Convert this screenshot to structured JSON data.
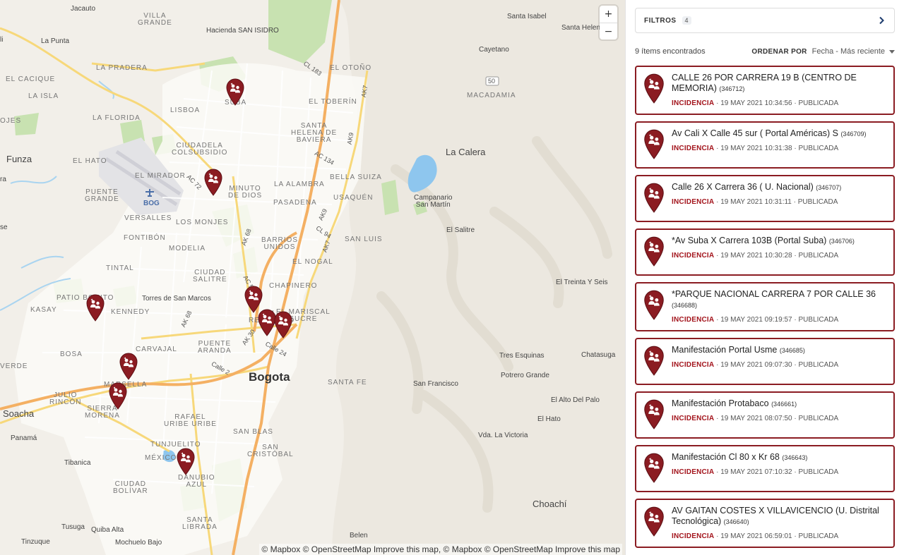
{
  "colors": {
    "accent": "#8b1c22",
    "incident_red": "#a3141c",
    "map_land": "#f2efe9",
    "park_green": "#c8e2b1",
    "water": "#8ec6ee",
    "highway_orange": "#f4b063",
    "main_road_yellow": "#f7d87a"
  },
  "map": {
    "zoom": {
      "in_label": "+",
      "out_label": "−"
    },
    "attribution": "© Mapbox © OpenStreetMap Improve this map, © Mapbox © OpenStreetMap Improve this map",
    "labels": {
      "jacauto": "Jacauto",
      "villa_grande": "VILLA\nGRANDE",
      "hacienda": "Hacienda SAN ISIDRO",
      "santa_isabel": "Santa Isabel",
      "santa_helena": "Santa Helena",
      "la_punta": "La Punta",
      "cayetano": "Cayetano",
      "la_pradera": "LA PRADERA",
      "el_otono": "EL OTOÑO",
      "el_cacique": "EL CACIQUE",
      "macadamia": "MACADAMIA",
      "la_isla": "LA ISLA",
      "suba": "SUBA",
      "el_tobern": "EL TOBERÍN",
      "lisboa": "LISBOA",
      "la_florida": "LA FLORIDA",
      "santa_helena_baviera": "SANTA\nHELENA DE\nBAVIERA",
      "ciudadela": "CIUDADELA\nCOLSUBSIDIO",
      "funza": "Funza",
      "el_hato": "EL HATO",
      "la_calera": "La Calera",
      "el_mirador": "EL MIRADOR",
      "minuto": "MINUTO\nDE DIOS",
      "la_alambra": "LA ALAMBRA",
      "bella_suiza": "BELLA SUIZA",
      "puente_grande": "PUENTE\nGRANDE",
      "bog": "BOG",
      "campanario": "Campanario\nSan Martín",
      "usaquen": "USAQUÉN",
      "pasadena": "PASADENA",
      "versalles": "VERSALLES",
      "los_monjes": "LOS MONJES",
      "el_salitre": "El Salitre",
      "fontibon": "FONTIBÓN",
      "barrios_unidos": "BARRIOS\nUNIDOS",
      "san_luis": "SAN LUIS",
      "modelia": "MODELIA",
      "el_nogal": "EL NOGAL",
      "tintal": "TINTAL",
      "ciudad_salitre": "CIUDAD\nSALITRE",
      "el_treinta": "El Treinta Y Seis",
      "chapinero": "CHAPINERO",
      "patio_bonito": "PATIO BONITO",
      "torres": "Torres de San Marcos",
      "kasay": "KASAY",
      "kennedy": "KENNEDY",
      "el_recuerdo": "EL\nRECUERDO",
      "el_mariscal": "EL MARISCAL\nSUCRE",
      "bosa": "BOSA",
      "carvajal": "CARVAJAL",
      "puente_aranda": "PUENTE\nARANDA",
      "tres_esquinas": "Tres Esquinas",
      "chatasuga": "Chatasuga",
      "potrero_grande": "Potrero Grande",
      "verde": "VERDE",
      "bogota": "Bogota",
      "santa_fe": "SANTA FE",
      "san_francisco": "San Francisco",
      "marsella": "MARSELLA",
      "julio_rincon": "JULIO\nRINCÓN",
      "sierra_morena": "SIERRA\nMORENA",
      "rafael_uribe": "RAFAEL\nURIBE URIBE",
      "el_alto": "El Alto Del Palo",
      "soacha": "Soacha",
      "el_hato_east": "El Hato",
      "san_blas": "SAN BLAS",
      "panama": "Panamá",
      "vda_victoria": "Vda. La Victoria",
      "tunjuelito": "TUNJUELITO",
      "san_cristobal": "SAN\nCRISTÓBAL",
      "mexico": "MÉXICO",
      "danubio": "DANUBIO\nAZUL",
      "tibanica": "Tibanica",
      "ciudad_bolivar": "CIUDAD\nBOLÍVAR",
      "choachi": "Choachí",
      "santa_librada": "SANTA\nLIBRADA",
      "tusuga": "Tusuga",
      "quiba": "Quiba Alta",
      "belen": "Belen",
      "tinzuque": "Tinzuque",
      "mochuelo": "Mochuelo Bajo",
      "cl183": "CL 183",
      "ak7a": "AK7",
      "ak9": "AK9",
      "ac134": "AC 134",
      "ac72": "AC 72",
      "ak68": "AK 68",
      "ak9b": "AK9",
      "cl94": "CL 94",
      "ak7b": "AK7",
      "ac53": "AC 53",
      "ak68b": "AK 68",
      "ak30": "AK 30",
      "calle24": "Calle 24",
      "calle2": "Calle 2",
      "rt50": "50",
      "ve": "se",
      "ra": "ra",
      "li": "li",
      "ojes": "OJES"
    }
  },
  "panel": {
    "filters": {
      "label": "FILTROS",
      "count": "4"
    },
    "results_text": "9 ítems encontrados",
    "sort": {
      "label": "ORDENAR POR",
      "value": "Fecha - Más reciente"
    },
    "items": [
      {
        "title": "CALLE 26 POR CARRERA 19 B (CENTRO DE MEMORIA)",
        "code": "(346712)",
        "category": "INCIDENCIA",
        "date": "19 MAY 2021 10:34:56",
        "status": "PUBLICADA"
      },
      {
        "title": "Av Cali X Calle 45 sur ( Portal Américas) S",
        "code": "(346709)",
        "category": "INCIDENCIA",
        "date": "19 MAY 2021 10:31:38",
        "status": "PUBLICADA"
      },
      {
        "title": "Calle 26 X Carrera 36 ( U. Nacional)",
        "code": "(346707)",
        "category": "INCIDENCIA",
        "date": "19 MAY 2021 10:31:11",
        "status": "PUBLICADA"
      },
      {
        "title": "*Av Suba X Carrera 103B (Portal Suba)",
        "code": "(346706)",
        "category": "INCIDENCIA",
        "date": "19 MAY 2021 10:30:28",
        "status": "PUBLICADA"
      },
      {
        "title": "*PARQUE NACIONAL CARRERA 7 POR CALLE 36",
        "code": "(346688)",
        "category": "INCIDENCIA",
        "date": "19 MAY 2021 09:19:57",
        "status": "PUBLICADA"
      },
      {
        "title": "Manifestación Portal Usme",
        "code": "(346685)",
        "category": "INCIDENCIA",
        "date": "19 MAY 2021 09:07:30",
        "status": "PUBLICADA"
      },
      {
        "title": "Manifestación Protabaco",
        "code": "(346661)",
        "category": "INCIDENCIA",
        "date": "19 MAY 2021 08:07:50",
        "status": "PUBLICADA"
      },
      {
        "title": "Manifestación Cl 80 x Kr 68",
        "code": "(346643)",
        "category": "INCIDENCIA",
        "date": "19 MAY 2021 07:10:32",
        "status": "PUBLICADA"
      },
      {
        "title": "AV GAITAN COSTES X VILLAVICENCIO (U. Distrital Tecnológica)",
        "code": "(346640)",
        "category": "INCIDENCIA",
        "date": "19 MAY 2021 06:59:01",
        "status": "PUBLICADA"
      }
    ]
  }
}
